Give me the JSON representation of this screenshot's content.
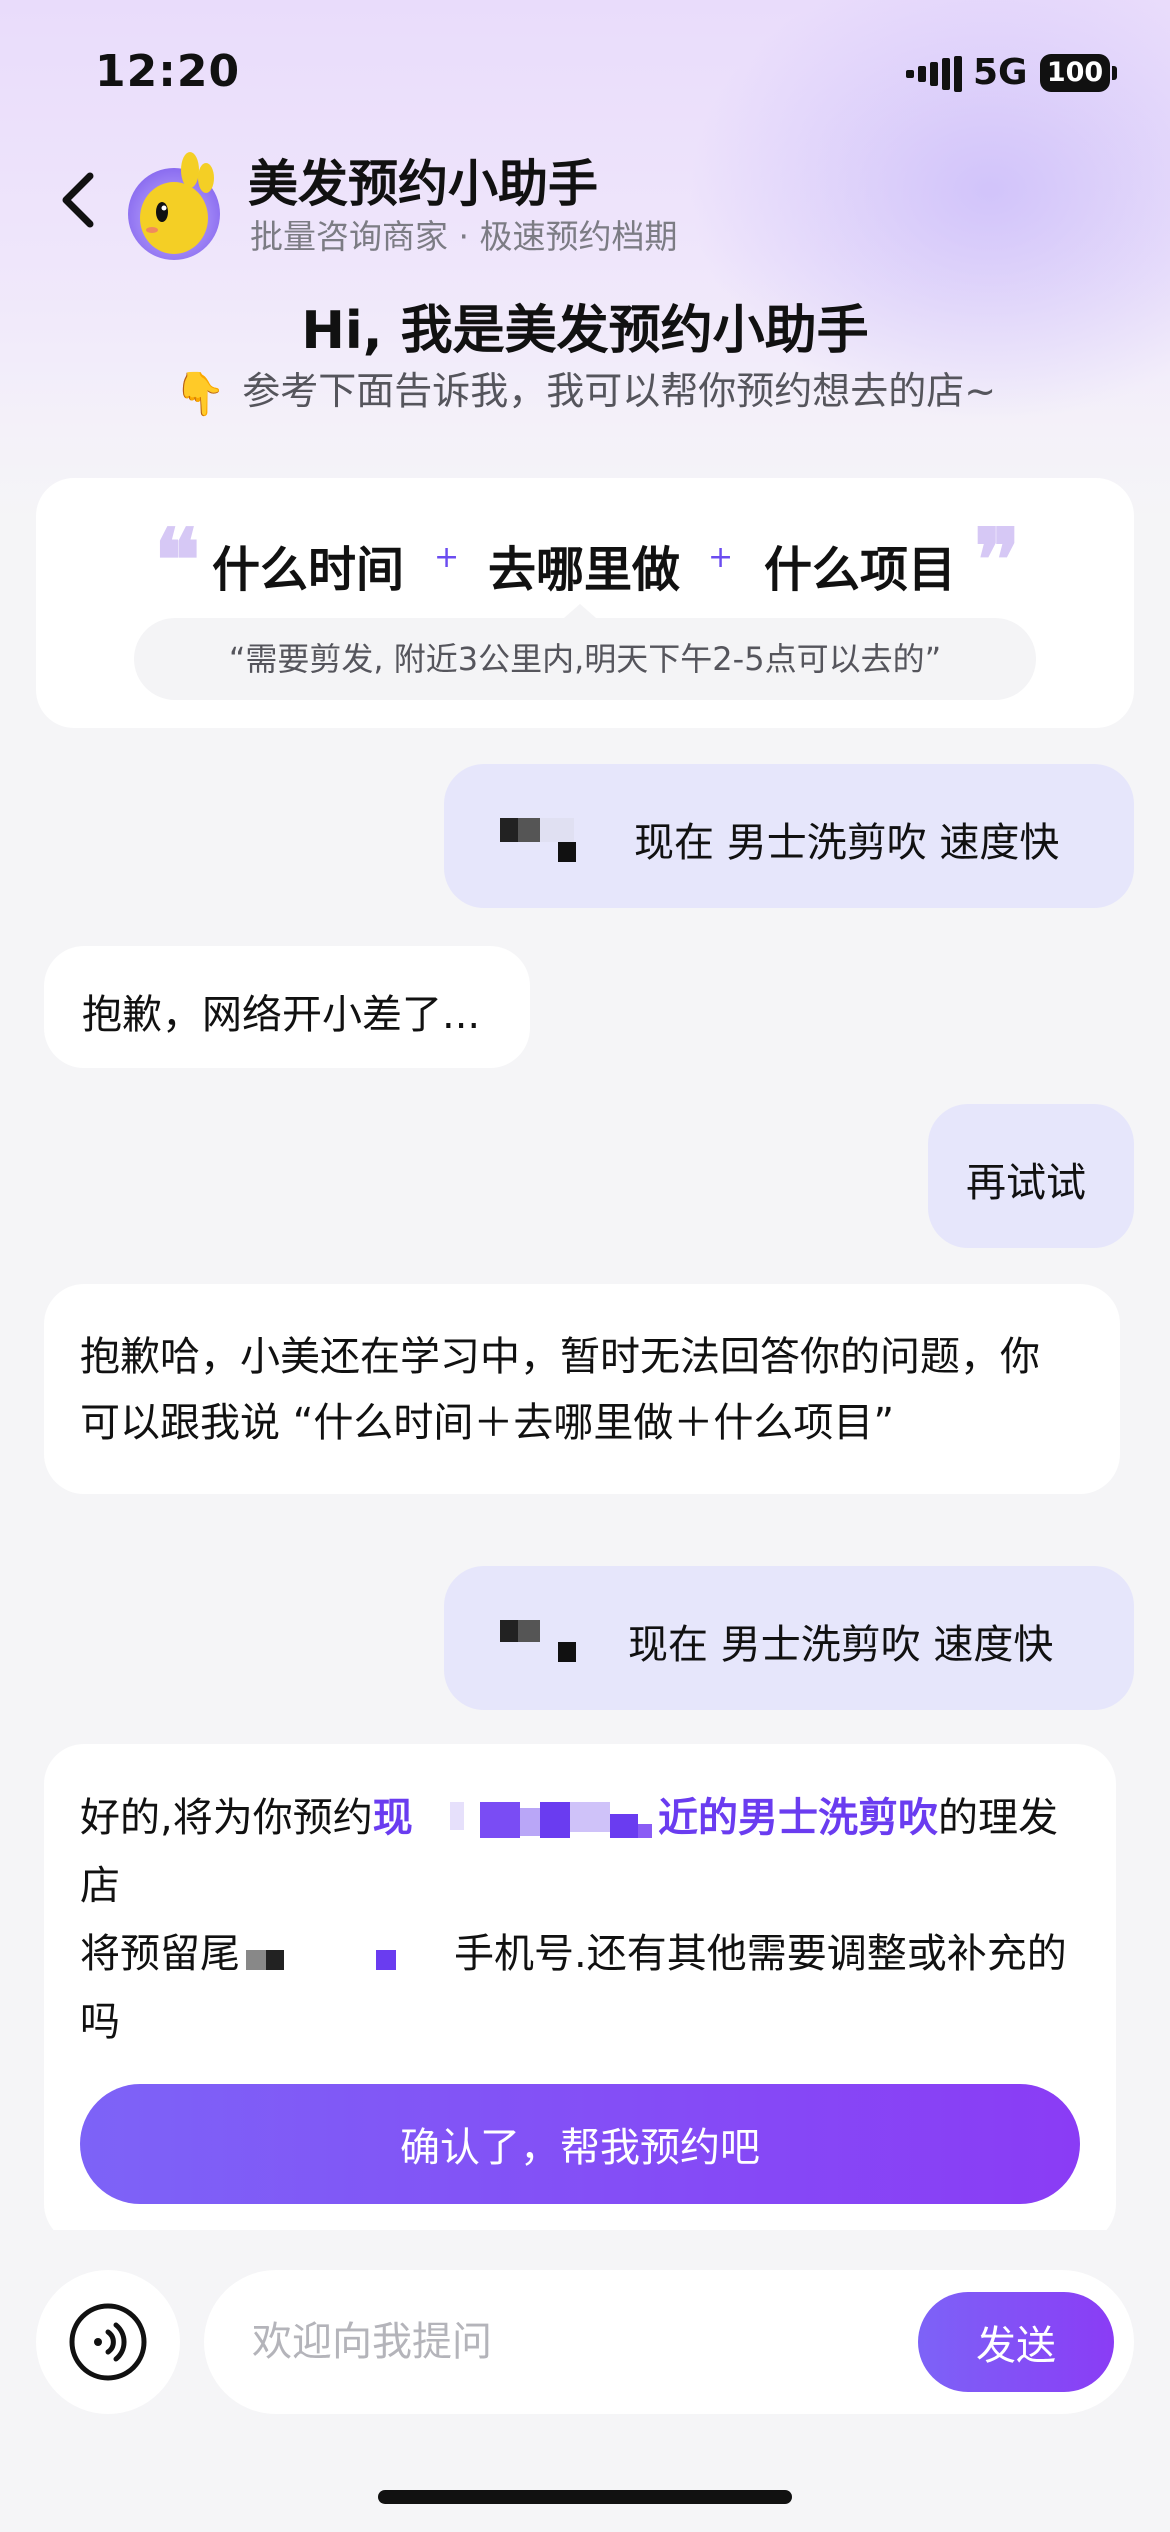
{
  "status_bar": {
    "time": "12:20",
    "network": "5G",
    "battery": "100"
  },
  "header": {
    "title": "美发预约小助手",
    "subtitle": "批量咨询商家 · 极速预约档期",
    "back_icon": "chevron-left-icon",
    "avatar_icon": "yellow-mascot-avatar"
  },
  "greeting": {
    "title": "Hi, 我是美发预约小助手",
    "hint_icon": "👇",
    "hint": "参考下面告诉我，我可以帮你预约想去的店~"
  },
  "template_card": {
    "quote_open": "❝",
    "quote_close": "❞",
    "parts": [
      "什么时间",
      "去哪里做",
      "什么项目"
    ],
    "plus": "+",
    "example": "“需要剪发, 附近3公里内,明天下午2-5点可以去的”"
  },
  "messages": [
    {
      "role": "user",
      "text": "现在 男士洗剪吹 速度快"
    },
    {
      "role": "bot",
      "text": "抱歉，网络开小差了..."
    },
    {
      "role": "user",
      "text": "再试试"
    },
    {
      "role": "bot",
      "lines": [
        "抱歉哈，小美还在学习中，暂时无法回答你的问题，你",
        "可以跟我说 “什么时间＋去哪里做＋什么项目”"
      ]
    },
    {
      "role": "user",
      "text": "现在 男士洗剪吹 速度快"
    },
    {
      "role": "bot",
      "prefix": "好的,将为你预约",
      "highlight_start": "现",
      "highlight_end": "近的男士洗剪吹",
      "suffix": "的理发",
      "line2": "店",
      "line3_start": "将预留尾",
      "line3_end": "手机号.还有其他需要调整或补充的",
      "line4": "吗",
      "action_button": "确认了，帮我预约吧"
    }
  ],
  "input_bar": {
    "voice_icon": "voice-input-icon",
    "placeholder": "欢迎向我提问",
    "send_label": "发送"
  },
  "colors": {
    "accent": "#7a4cf4",
    "user_bubble": "#e6e6fb",
    "background": "#f5f5f7"
  }
}
